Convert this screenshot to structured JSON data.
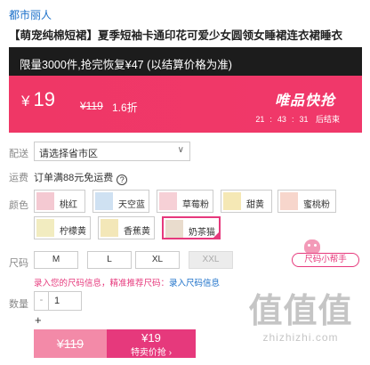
{
  "brand": "都市丽人",
  "title": "【萌宠纯棉短裙】夏季短袖卡通印花可爱少女圆领女睡裙连衣裙睡衣",
  "promo": {
    "limit_text": "限量3000件,抢完恢复¥47 (以结算价格为准)",
    "currency": "¥",
    "price": "19",
    "original_price": "¥119",
    "discount": "1.6折",
    "flash_label": "唯品快抢",
    "countdown": {
      "h": "21",
      "sep1": ":",
      "m": "43",
      "sep2": ":",
      "s": "31",
      "suffix": "后结束"
    }
  },
  "delivery": {
    "label": "配送",
    "placeholder": "请选择省市区",
    "chevron": "∨"
  },
  "shipping": {
    "label": "运费",
    "text": "订单满88元免运费",
    "help_icon": "help-circle-icon",
    "help_glyph": "?"
  },
  "colors": {
    "label": "颜色",
    "options": [
      {
        "name": "桃红",
        "swatch": "#f4c9d2",
        "selected": false
      },
      {
        "name": "天空蓝",
        "swatch": "#cfe1f2",
        "selected": false
      },
      {
        "name": "草莓粉",
        "swatch": "#f6d0d6",
        "selected": false
      },
      {
        "name": "甜黄",
        "swatch": "#f5e8b5",
        "selected": false
      },
      {
        "name": "蜜桃粉",
        "swatch": "#f7d6cc",
        "selected": false
      },
      {
        "name": "柠檬黄",
        "swatch": "#f2ecc0",
        "selected": false
      },
      {
        "name": "香蕉黄",
        "swatch": "#f3e7b8",
        "selected": false
      },
      {
        "name": "奶茶猫",
        "swatch": "#e9dccd",
        "selected": true
      }
    ]
  },
  "sizes": {
    "label": "尺码",
    "options": [
      {
        "name": "M",
        "disabled": false
      },
      {
        "name": "L",
        "disabled": false
      },
      {
        "name": "XL",
        "disabled": false
      },
      {
        "name": "XXL",
        "disabled": true
      }
    ],
    "helper": "尺码小帮手",
    "note_main": "录入您的尺码信息，精准推荐尺码：",
    "note_link": "录入尺码信息"
  },
  "quantity": {
    "label": "数量",
    "value": "1",
    "minus": "-",
    "plus": "+"
  },
  "buy": {
    "original": "¥119",
    "price": "¥19",
    "cta": "特卖价抢 ›"
  },
  "watermark": {
    "logo": "值值值",
    "url": "zhizhizhi.com"
  },
  "colors_theme": {
    "accent": "#e6397c",
    "link": "#1a6fc9",
    "promo_bg": "#ef3766",
    "dark_bar": "#1c1c1c"
  }
}
